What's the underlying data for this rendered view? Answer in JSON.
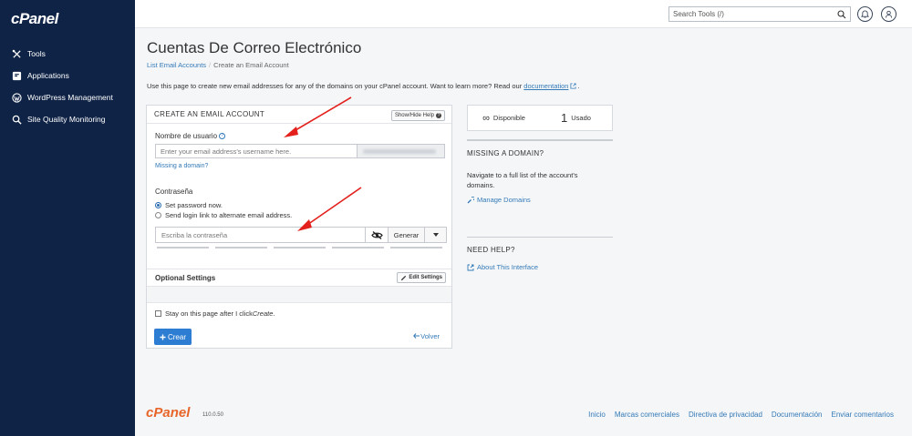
{
  "brand": {
    "logo": "cPanel"
  },
  "sidebar": {
    "items": [
      {
        "label": "Tools",
        "icon": "tools-icon"
      },
      {
        "label": "Applications",
        "icon": "applications-icon"
      },
      {
        "label": "WordPress Management",
        "icon": "wordpress-icon"
      },
      {
        "label": "Site Quality Monitoring",
        "icon": "search-icon"
      }
    ]
  },
  "topbar": {
    "search_placeholder": "Search Tools (/)"
  },
  "page": {
    "title": "Cuentas De Correo Electrónico",
    "breadcrumb": {
      "parent": "List Email Accounts",
      "current": "Create an Email Account"
    },
    "intro_text": "Use this page to create new email addresses for any of the domains on your cPanel account. Want to learn more? Read our ",
    "intro_link": "documentation",
    "intro_end": "."
  },
  "form": {
    "header": "CREATE AN EMAIL ACCOUNT",
    "help_button": "Show/Hide Help",
    "username_label": "Nombre de usuario",
    "username_placeholder": "Enter your email address's username here.",
    "missing_domain_link": "Missing a domain?",
    "password_label": "Contraseña",
    "radio_options": [
      {
        "label": "Set password now.",
        "checked": true
      },
      {
        "label": "Send login link to alternate email address.",
        "checked": false
      }
    ],
    "password_placeholder": "Escriba la contraseña",
    "generate_button": "Generar",
    "optional_settings": "Optional Settings",
    "edit_settings_button": "Edit Settings",
    "stay_text": "Stay on this page after I click ",
    "stay_emph": "Create",
    "stay_end": ".",
    "create_button": "Crear",
    "back_link": "Volver"
  },
  "stats": {
    "available_value": "∞",
    "available_label": "Disponible",
    "used_value": "1",
    "used_label": "Usado"
  },
  "missing_domain_panel": {
    "title": "MISSING A DOMAIN?",
    "text": "Navigate to a full list of the account's domains.",
    "link": "Manage Domains"
  },
  "help_panel": {
    "title": "NEED HELP?",
    "link": "About This Interface"
  },
  "footer": {
    "logo": "cPanel",
    "version": "110.0.50",
    "links": [
      "Inicio",
      "Marcas comerciales",
      "Directiva de privacidad",
      "Documentación",
      "Enviar comentarios"
    ]
  },
  "colors": {
    "sidebar_bg": "#0f2346",
    "accent": "#337ab7",
    "primary_button": "#2d7dd2",
    "annotation_arrow": "#e3201b",
    "footer_logo": "#e8652a"
  }
}
